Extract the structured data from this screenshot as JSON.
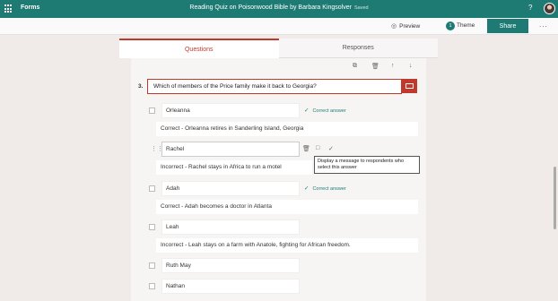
{
  "header": {
    "app_name": "Forms",
    "doc_title": "Reading Quiz on Poisonwood Bible by Barbara Kingsolver",
    "save_status": "Saved",
    "help": "?"
  },
  "toolbar": {
    "preview_label": "Preview",
    "theme_label": "Theme",
    "theme_badge": "1",
    "share_label": "Share",
    "more": "..."
  },
  "tabs": [
    {
      "label": "Questions",
      "active": true
    },
    {
      "label": "Responses",
      "active": false
    }
  ],
  "question": {
    "number": "3.",
    "text": "Which of members of the Price family make it back to Georgia?",
    "options": [
      {
        "label": "Orleanna",
        "correct_label": "Correct answer",
        "feedback": "Correct - Orleanna retires in Sanderling Island, Georgia"
      },
      {
        "label": "Rachel",
        "correct_label": "",
        "feedback": "Incorrect - Rachel stays in Africa to run a motel"
      },
      {
        "label": "Adah",
        "correct_label": "Correct answer",
        "feedback": "Correct - Adah becomes a doctor in Atlanta"
      },
      {
        "label": "Leah",
        "correct_label": "",
        "feedback": "Incorrect - Leah stays on a farm with Anatole, fighting for African freedom."
      },
      {
        "label": "Ruth May",
        "correct_label": "",
        "feedback": ""
      },
      {
        "label": "Nathan",
        "correct_label": "",
        "feedback": ""
      }
    ]
  },
  "tooltip": "Display a message to respondents who select this answer",
  "colors": {
    "brand": "#1e7b74",
    "accent": "#c0392b"
  }
}
